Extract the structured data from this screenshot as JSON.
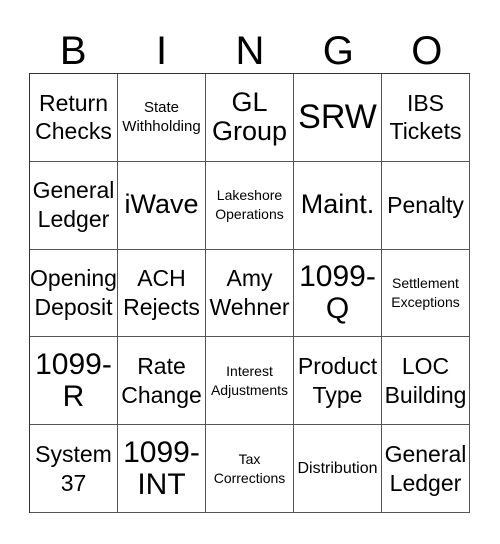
{
  "header": {
    "letters": [
      "B",
      "I",
      "N",
      "G",
      "O"
    ]
  },
  "cells": [
    [
      "Return Checks",
      "State Withholding",
      "GL Group",
      "SRW",
      "IBS Tickets"
    ],
    [
      "General Ledger",
      "iWave",
      "Lakeshore Operations",
      "Maint.",
      "Penalty"
    ],
    [
      "Opening Deposit",
      "ACH Rejects",
      "Amy Wehner",
      "1099-Q",
      "Settlement Exceptions"
    ],
    [
      "1099-R",
      "Rate Change",
      "Interest Adjustments",
      "Product Type",
      "LOC Building"
    ],
    [
      "System 37",
      "1099-INT",
      "Tax Corrections",
      "Distribution",
      "General Ledger"
    ]
  ],
  "cell_lines": [
    [
      [
        "Return",
        "Checks"
      ],
      [
        "State",
        "Withholding"
      ],
      [
        "GL",
        "Group"
      ],
      [
        "SRW"
      ],
      [
        "IBS",
        "Tickets"
      ]
    ],
    [
      [
        "General",
        "Ledger"
      ],
      [
        "iWave"
      ],
      [
        "Lakeshore",
        "Operations"
      ],
      [
        "Maint."
      ],
      [
        "Penalty"
      ]
    ],
    [
      [
        "Opening",
        "Deposit"
      ],
      [
        "ACH",
        "Rejects"
      ],
      [
        "Amy",
        "Wehner"
      ],
      [
        "1099-",
        "Q"
      ],
      [
        "Settlement",
        "Exceptions"
      ]
    ],
    [
      [
        "1099-",
        "R"
      ],
      [
        "Rate",
        "Change"
      ],
      [
        "Interest",
        "Adjustments"
      ],
      [
        "Product",
        "Type"
      ],
      [
        "LOC",
        "Building"
      ]
    ],
    [
      [
        "System",
        "37"
      ],
      [
        "1099-",
        "INT"
      ],
      [
        "Tax",
        "Corrections"
      ],
      [
        "Distribution"
      ],
      [
        "General",
        "Ledger"
      ]
    ]
  ]
}
